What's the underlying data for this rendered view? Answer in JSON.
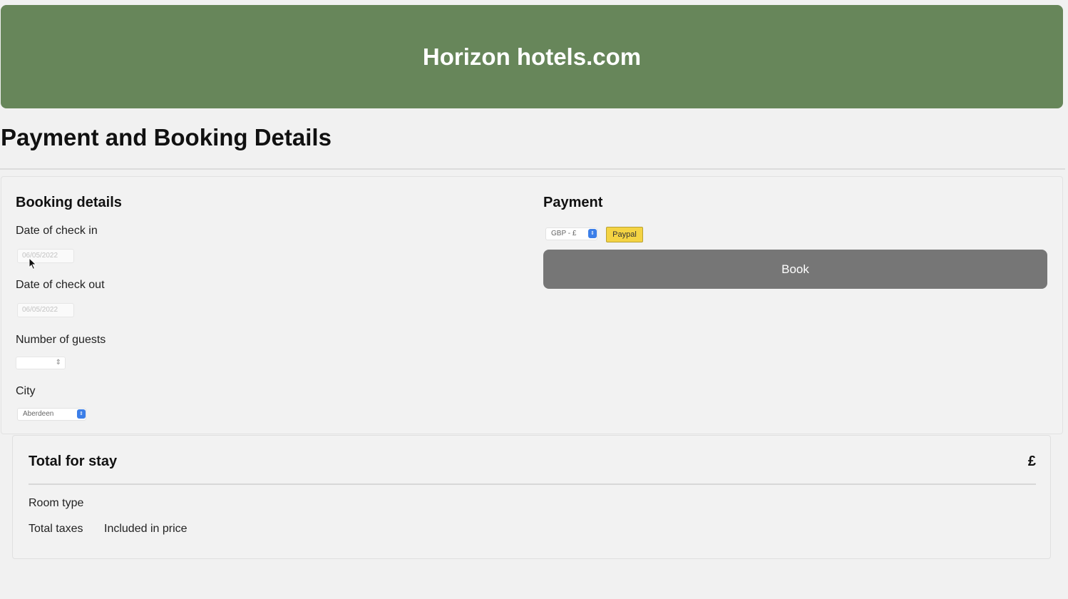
{
  "header": {
    "title": "Horizon hotels.com",
    "bg_color": "#67865a"
  },
  "page": {
    "title": "Payment and Booking Details"
  },
  "booking": {
    "title": "Booking details",
    "checkin_label": "Date of check in",
    "checkin_value": "06/05/2022",
    "checkout_label": "Date of check out",
    "checkout_value": "06/05/2022",
    "guests_label": "Number of guests",
    "guests_value": "",
    "city_label": "City",
    "city_value": "Aberdeen"
  },
  "payment": {
    "title": "Payment",
    "currency_value": "GBP - £",
    "paypal_label": "Paypal",
    "book_label": "Book"
  },
  "totals": {
    "title": "Total for stay",
    "amount": "£",
    "room_type_label": "Room type",
    "taxes_label": "Total taxes",
    "taxes_value": "Included in price"
  },
  "icons": {
    "cursor": "mouse-pointer-icon",
    "select_arrow": "chevron-up-down-icon",
    "spinner": "spinner-arrows-icon"
  }
}
